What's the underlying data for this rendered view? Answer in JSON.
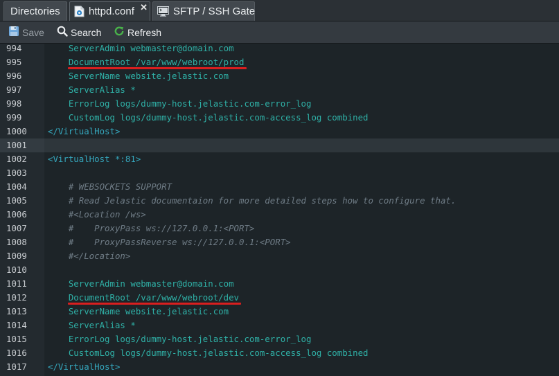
{
  "tabs": [
    {
      "label": "Directories",
      "icon": "none",
      "active": false,
      "closable": false
    },
    {
      "label": "httpd.conf",
      "icon": "config-file-icon",
      "active": true,
      "closable": true
    },
    {
      "label": "SFTP / SSH Gate",
      "icon": "monitor-icon",
      "active": false,
      "closable": false
    }
  ],
  "toolbar": {
    "save_label": "Save",
    "search_label": "Search",
    "refresh_label": "Refresh"
  },
  "colors": {
    "accent_underline": "#d91f1f",
    "code_text": "#2fb1a7",
    "comment_text": "#6f7c86",
    "background": "#1d2428"
  },
  "editor": {
    "active_line": 1001,
    "lines": [
      {
        "n": "994",
        "text": "    ServerAdmin webmaster@domain.com",
        "type": "plain"
      },
      {
        "n": "995",
        "text": "    DocumentRoot /var/www/webroot/prod",
        "type": "plain",
        "underline": true
      },
      {
        "n": "996",
        "text": "    ServerName website.jelastic.com",
        "type": "plain"
      },
      {
        "n": "997",
        "text": "    ServerAlias *",
        "type": "plain"
      },
      {
        "n": "998",
        "text": "    ErrorLog logs/dummy-host.jelastic.com-error_log",
        "type": "plain"
      },
      {
        "n": "999",
        "text": "    CustomLog logs/dummy-host.jelastic.com-access_log combined",
        "type": "plain"
      },
      {
        "n": "1000",
        "text": "</VirtualHost>",
        "type": "tag"
      },
      {
        "n": "1001",
        "text": "",
        "type": "plain"
      },
      {
        "n": "1002",
        "text": "<VirtualHost *:81>",
        "type": "tag"
      },
      {
        "n": "1003",
        "text": "",
        "type": "plain"
      },
      {
        "n": "1004",
        "text": "    # WEBSOCKETS SUPPORT",
        "type": "comment"
      },
      {
        "n": "1005",
        "text": "    # Read Jelastic documentaion for more detailed steps how to configure that.",
        "type": "comment"
      },
      {
        "n": "1006",
        "text": "    #<Location /ws>",
        "type": "comment"
      },
      {
        "n": "1007",
        "text": "    #    ProxyPass ws://127.0.0.1:<PORT>",
        "type": "comment"
      },
      {
        "n": "1008",
        "text": "    #    ProxyPassReverse ws://127.0.0.1:<PORT>",
        "type": "comment"
      },
      {
        "n": "1009",
        "text": "    #</Location>",
        "type": "comment"
      },
      {
        "n": "1010",
        "text": "",
        "type": "plain"
      },
      {
        "n": "1011",
        "text": "    ServerAdmin webmaster@domain.com",
        "type": "plain"
      },
      {
        "n": "1012",
        "text": "    DocumentRoot /var/www/webroot/dev",
        "type": "plain",
        "underline": true
      },
      {
        "n": "1013",
        "text": "    ServerName website.jelastic.com",
        "type": "plain"
      },
      {
        "n": "1014",
        "text": "    ServerAlias *",
        "type": "plain"
      },
      {
        "n": "1015",
        "text": "    ErrorLog logs/dummy-host.jelastic.com-error_log",
        "type": "plain"
      },
      {
        "n": "1016",
        "text": "    CustomLog logs/dummy-host.jelastic.com-access_log combined",
        "type": "plain"
      },
      {
        "n": "1017",
        "text": "</VirtualHost>",
        "type": "tag"
      }
    ]
  }
}
